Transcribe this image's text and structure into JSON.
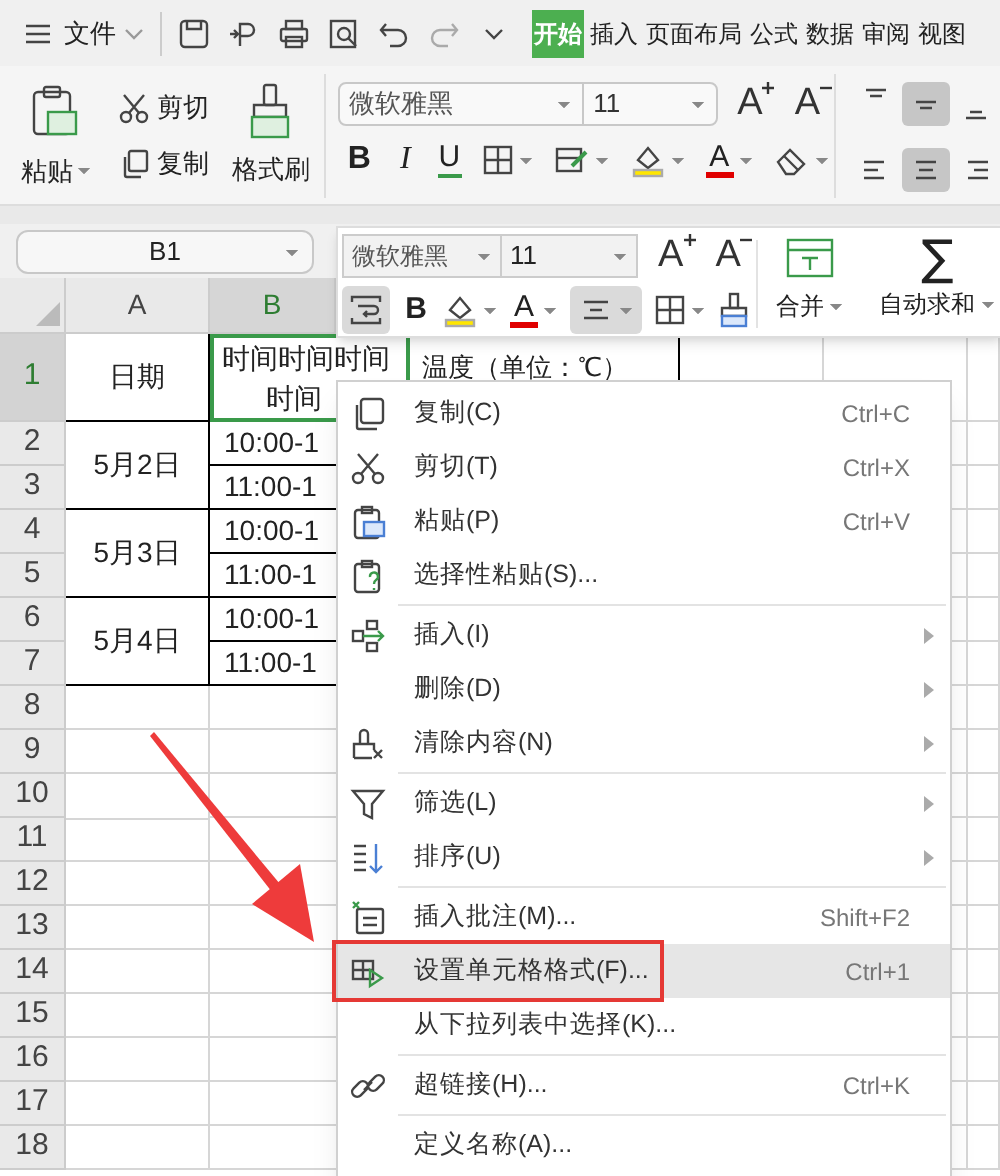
{
  "title_bar": {
    "file_menu": "文件",
    "tabs": [
      {
        "label": "开始",
        "selected": true
      },
      {
        "label": "插入",
        "selected": false
      },
      {
        "label": "页面布局",
        "selected": false
      },
      {
        "label": "公式",
        "selected": false
      },
      {
        "label": "数据",
        "selected": false
      },
      {
        "label": "审阅",
        "selected": false
      },
      {
        "label": "视图",
        "selected": false
      }
    ]
  },
  "ribbon": {
    "paste": "粘贴",
    "cut": "剪切",
    "copy": "复制",
    "format_painter": "格式刷",
    "font": "微软雅黑",
    "font_size": "11",
    "grow_font": "A",
    "shrink_font": "A",
    "bold": "B",
    "italic": "I",
    "underline": "U",
    "font_color": "A",
    "vertical_align": [
      {
        "selected": false
      },
      {
        "selected": true
      },
      {
        "selected": false
      }
    ],
    "horizontal_align": [
      {
        "selected": false
      },
      {
        "selected": true
      },
      {
        "selected": false
      }
    ]
  },
  "name_box": "B1",
  "sheet": {
    "columns": [
      {
        "label": "A",
        "selected": false
      },
      {
        "label": "B",
        "selected": true
      }
    ],
    "row_numbers": [
      {
        "label": "1",
        "selected": true
      },
      {
        "label": "2",
        "selected": false
      },
      {
        "label": "3",
        "selected": false
      },
      {
        "label": "4",
        "selected": false
      },
      {
        "label": "5",
        "selected": false
      },
      {
        "label": "6",
        "selected": false
      },
      {
        "label": "7",
        "selected": false
      },
      {
        "label": "8",
        "selected": false
      },
      {
        "label": "9",
        "selected": false
      },
      {
        "label": "10",
        "selected": false
      },
      {
        "label": "11",
        "selected": false
      },
      {
        "label": "12",
        "selected": false
      },
      {
        "label": "13",
        "selected": false
      },
      {
        "label": "14",
        "selected": false
      },
      {
        "label": "15",
        "selected": false
      },
      {
        "label": "16",
        "selected": false
      },
      {
        "label": "17",
        "selected": false
      },
      {
        "label": "18",
        "selected": false
      }
    ],
    "header": {
      "date": "日期",
      "time_lines": [
        "时间时间时间",
        "时间"
      ],
      "time_selected": true,
      "temperature": "温度（单位：℃）"
    },
    "days": [
      {
        "date": "5月2日",
        "times": [
          "10:00-1",
          "11:00-1"
        ]
      },
      {
        "date": "5月3日",
        "times": [
          "10:00-1",
          "11:00-1"
        ]
      },
      {
        "date": "5月4日",
        "times": [
          "10:00-1",
          "11:00-1"
        ]
      }
    ]
  },
  "mini_toolbar": {
    "font": "微软雅黑",
    "font_size": "11",
    "grow_font": "A",
    "shrink_font": "A",
    "bold": "B",
    "font_color": "A",
    "merge": "合并",
    "autosum_symbol": "∑",
    "autosum": "自动求和",
    "wrap_selected": true,
    "center_selected": true
  },
  "context_menu": {
    "items": [
      {
        "kind": "item",
        "label": "复制(C)",
        "shortcut": "Ctrl+C",
        "submenu": false,
        "highlighted": false,
        "outlined": false
      },
      {
        "kind": "item",
        "label": "剪切(T)",
        "shortcut": "Ctrl+X",
        "submenu": false,
        "highlighted": false,
        "outlined": false
      },
      {
        "kind": "item",
        "label": "粘贴(P)",
        "shortcut": "Ctrl+V",
        "submenu": false,
        "highlighted": false,
        "outlined": false
      },
      {
        "kind": "item",
        "label": "选择性粘贴(S)...",
        "submenu": false,
        "highlighted": false,
        "outlined": false
      },
      {
        "kind": "separator"
      },
      {
        "kind": "item",
        "label": "插入(I)",
        "submenu": true,
        "highlighted": false,
        "outlined": false
      },
      {
        "kind": "item",
        "label": "删除(D)",
        "submenu": true,
        "highlighted": false,
        "outlined": false
      },
      {
        "kind": "item",
        "label": "清除内容(N)",
        "submenu": true,
        "highlighted": false,
        "outlined": false
      },
      {
        "kind": "separator"
      },
      {
        "kind": "item",
        "label": "筛选(L)",
        "submenu": true,
        "highlighted": false,
        "outlined": false
      },
      {
        "kind": "item",
        "label": "排序(U)",
        "submenu": true,
        "highlighted": false,
        "outlined": false
      },
      {
        "kind": "separator"
      },
      {
        "kind": "item",
        "label": "插入批注(M)...",
        "shortcut": "Shift+F2",
        "submenu": false,
        "highlighted": false,
        "outlined": false
      },
      {
        "kind": "item",
        "label": "设置单元格格式(F)...",
        "shortcut": "Ctrl+1",
        "submenu": false,
        "highlighted": true,
        "outlined": true
      },
      {
        "kind": "item",
        "label": "从下拉列表中选择(K)...",
        "submenu": false,
        "highlighted": false,
        "outlined": false
      },
      {
        "kind": "separator"
      },
      {
        "kind": "item",
        "label": "超链接(H)...",
        "shortcut": "Ctrl+K",
        "submenu": false,
        "highlighted": false,
        "outlined": false
      },
      {
        "kind": "separator"
      },
      {
        "kind": "item",
        "label": "定义名称(A)...",
        "submenu": false,
        "highlighted": false,
        "outlined": false
      }
    ]
  },
  "annotation": {
    "arrow": true
  }
}
